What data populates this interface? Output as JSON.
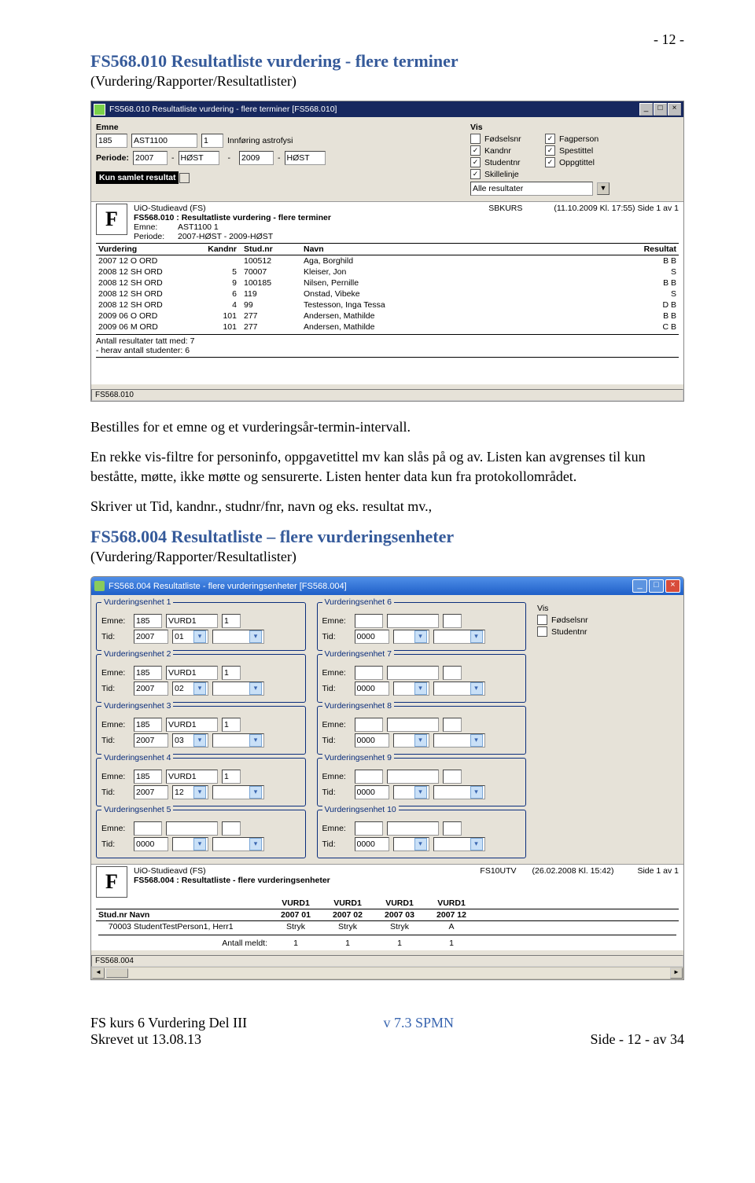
{
  "page_number_label": "- 12 -",
  "heading1": "FS568.010 Resultatliste vurdering - flere terminer",
  "sub1": "(Vurdering/Rapporter/Resultatlister)",
  "fig1": {
    "title": "FS568.010 Resultatliste vurdering - flere terminer [FS568.010]",
    "lbl_emne": "Emne",
    "emne_inst": "185",
    "emne_kode": "AST1100",
    "emne_nr": "1",
    "emne_navn": "Innføring astrofysi",
    "lbl_periode": "Periode:",
    "per_from_y": "2007",
    "per_from_t": "HØST",
    "per_to_y": "2009",
    "per_to_t": "HØST",
    "lbl_vis": "Vis",
    "chk_fodselsnr": "Fødselsnr",
    "chk_fagperson": "Fagperson",
    "chk_kandnr": "Kandnr",
    "chk_spestittel": "Spestittel",
    "chk_studentnr": "Studentnr",
    "chk_oppgtittel": "Oppgtittel",
    "chk_skillelinje": "Skillelinje",
    "sel_resultater": "Alle resultater",
    "lbl_kun_samlet": "Kun samlet resultat",
    "report": {
      "org": "UiO-Studieavd (FS)",
      "user": "SBKURS",
      "stamp": "(11.10.2009 Kl. 17:55)   Side 1 av 1",
      "title": "FS568.010 : Resultatliste vurdering - flere terminer",
      "l_emne": "Emne:",
      "v_emne": "AST1100 1",
      "l_per": "Periode:",
      "v_per": "2007-HØST - 2009-HØST",
      "cols": [
        "Vurdering",
        "Kandnr",
        "Stud.nr",
        "Navn",
        "Resultat"
      ],
      "rows": [
        [
          "2007 12 O ORD",
          "",
          "100512",
          "Aga, Borghild",
          "B B"
        ],
        [
          "2008 12 SH ORD",
          "5",
          "70007",
          "Kleiser, Jon",
          "S"
        ],
        [
          "2008 12 SH ORD",
          "9",
          "100185",
          "Nilsen, Pernille",
          "B B"
        ],
        [
          "2008 12 SH ORD",
          "6",
          "119",
          "Onstad, Vibeke",
          "S"
        ],
        [
          "2008 12 SH ORD",
          "4",
          "99",
          "Testesson, Inga Tessa",
          "D B"
        ],
        [
          "2009 06 O ORD",
          "101",
          "277",
          "Andersen, Mathilde",
          "B B"
        ],
        [
          "2009 06 M ORD",
          "101",
          "277",
          "Andersen, Mathilde",
          "C B"
        ]
      ],
      "sum1": "Antall resultater tatt med: 7",
      "sum2": "- herav antall studenter: 6",
      "status": "FS568.010"
    }
  },
  "para1": "Bestilles for et emne og et vurderingsår-termin-intervall.",
  "para2": "En rekke vis-filtre for personinfo, oppgavetittel mv kan slås på og av. Listen kan avgrenses til kun beståtte, møtte, ikke møtte og sensurerte. Listen henter data kun fra protokollområdet.",
  "para3": "Skriver ut Tid, kandnr., studnr/fnr, navn og eks. resultat mv.,",
  "heading2": "FS568.004 Resultatliste – flere vurderingsenheter",
  "sub2": "(Vurdering/Rapporter/Resultatlister)",
  "fig2": {
    "title": "FS568.004 Resultatliste - flere vurderingsenheter [FS568.004]",
    "lbl_vis": "Vis",
    "chk_fodselsnr": "Fødselsnr",
    "chk_studentnr": "Studentnr",
    "lbl_emne": "Emne:",
    "lbl_tid": "Tid:",
    "groups": [
      {
        "title": "Vurderingsenhet 1",
        "emne": [
          "185",
          "VURD1",
          "1"
        ],
        "tid": [
          "2007",
          "01"
        ]
      },
      {
        "title": "Vurderingsenhet 2",
        "emne": [
          "185",
          "VURD1",
          "1"
        ],
        "tid": [
          "2007",
          "02"
        ]
      },
      {
        "title": "Vurderingsenhet 3",
        "emne": [
          "185",
          "VURD1",
          "1"
        ],
        "tid": [
          "2007",
          "03"
        ]
      },
      {
        "title": "Vurderingsenhet 4",
        "emne": [
          "185",
          "VURD1",
          "1"
        ],
        "tid": [
          "2007",
          "12"
        ]
      },
      {
        "title": "Vurderingsenhet 5",
        "emne": [
          "",
          "",
          ""
        ],
        "tid": [
          "0000",
          ""
        ]
      },
      {
        "title": "Vurderingsenhet 6",
        "emne": [
          "",
          "",
          ""
        ],
        "tid": [
          "0000",
          ""
        ]
      },
      {
        "title": "Vurderingsenhet 7",
        "emne": [
          "",
          "",
          ""
        ],
        "tid": [
          "0000",
          ""
        ]
      },
      {
        "title": "Vurderingsenhet 8",
        "emne": [
          "",
          "",
          ""
        ],
        "tid": [
          "0000",
          ""
        ]
      },
      {
        "title": "Vurderingsenhet 9",
        "emne": [
          "",
          "",
          ""
        ],
        "tid": [
          "0000",
          ""
        ]
      },
      {
        "title": "Vurderingsenhet 10",
        "emne": [
          "",
          "",
          ""
        ],
        "tid": [
          "0000",
          ""
        ]
      }
    ],
    "report": {
      "org": "UiO-Studieavd (FS)",
      "user": "FS10UTV",
      "stamp": "(26.02.2008 Kl. 15:42)",
      "pg": "Side 1 av 1",
      "title": "FS568.004 : Resultatliste - flere vurderingsenheter",
      "cols_top": [
        "VURD1",
        "VURD1",
        "VURD1",
        "VURD1"
      ],
      "cols_sub": [
        "2007 01",
        "2007 02",
        "2007 03",
        "2007 12"
      ],
      "rowhead": "Stud.nr Navn",
      "row": [
        "70003",
        "StudentTestPerson1, Herr1",
        "Stryk",
        "Stryk",
        "Stryk",
        "A"
      ],
      "antall_lbl": "Antall meldt:",
      "antall": [
        "1",
        "1",
        "1",
        "1"
      ],
      "status": "FS568.004"
    }
  },
  "footer": {
    "l1": "FS kurs 6 Vurdering Del III",
    "l2": "Skrevet ut 13.08.13",
    "mid": "v 7.3 SPMN",
    "right": "Side - 12 - av 34"
  }
}
